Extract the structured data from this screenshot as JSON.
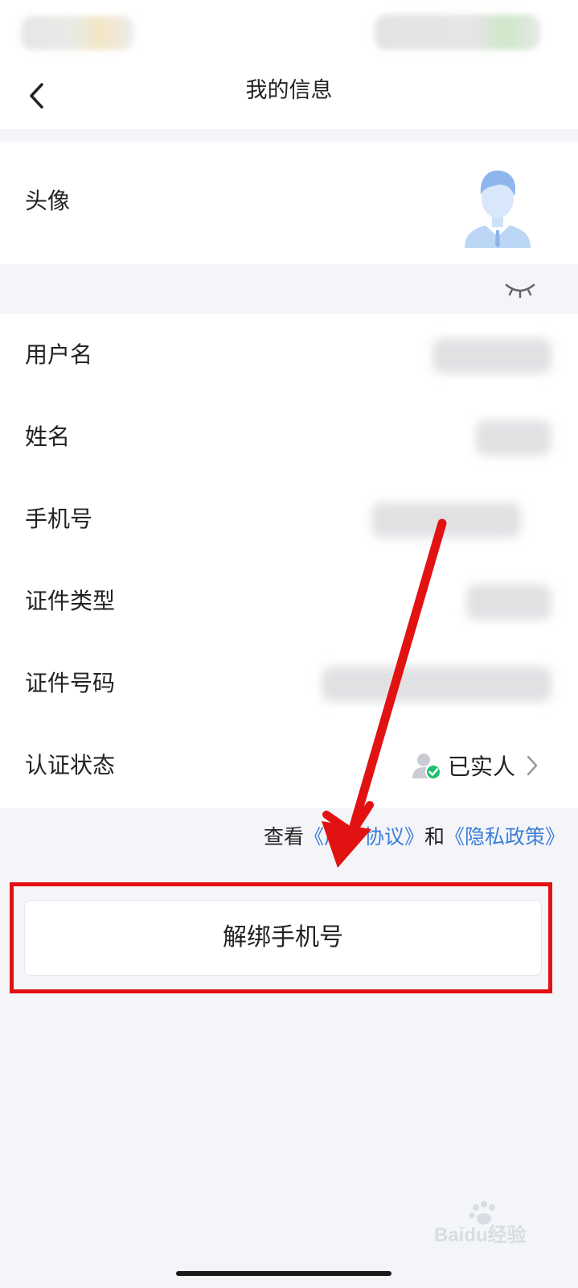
{
  "header": {
    "title": "我的信息"
  },
  "profile": {
    "avatar_label": "头像"
  },
  "info_rows": {
    "username_label": "用户名",
    "name_label": "姓名",
    "phone_label": "手机号",
    "id_type_label": "证件类型",
    "id_number_label": "证件号码",
    "auth_label": "认证状态",
    "auth_value": "已实人"
  },
  "agreement": {
    "prefix": "查看",
    "user_agreement": "《用户协议》",
    "conjunction": "和",
    "privacy_policy": "《隐私政策》"
  },
  "actions": {
    "unbind_label": "解绑手机号"
  },
  "icons": [
    "back-icon",
    "avatar",
    "eye-closed-icon",
    "verified-user-icon",
    "chevron-right-icon",
    "red-arrow-annotation"
  ],
  "colors": {
    "link": "#3d7fd6",
    "annotation_red": "#e31212",
    "verified_green": "#1fbf6b",
    "page_bg": "#f4f5f9"
  },
  "watermark": {
    "text": "Baidu经验"
  }
}
